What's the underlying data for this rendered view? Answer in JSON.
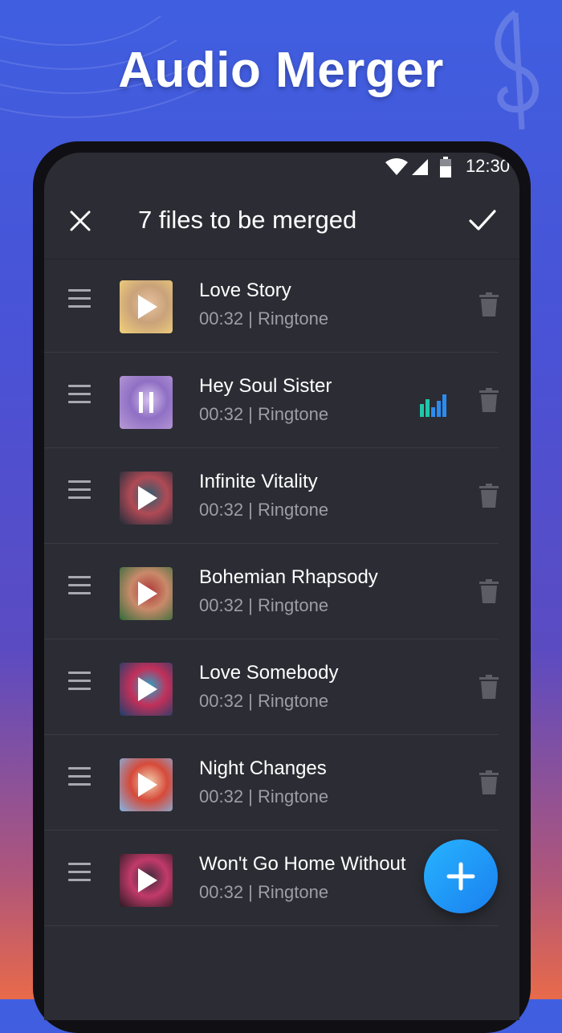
{
  "promo": {
    "title": "Audio Merger"
  },
  "status_bar": {
    "time": "12:30"
  },
  "app_bar": {
    "title": "7 files to be merged"
  },
  "tracks": [
    {
      "title": "Love Story",
      "meta": "00:32 | Ringtone",
      "state": "paused-play",
      "thumb_colors": [
        "#f2d27a",
        "#c9a27a",
        "#e7c2a0"
      ]
    },
    {
      "title": "Hey Soul Sister",
      "meta": "00:32 | Ringtone",
      "state": "playing",
      "thumb_colors": [
        "#b79ad6",
        "#8f6fc4",
        "#d6c2ee"
      ]
    },
    {
      "title": "Infinite Vitality",
      "meta": "00:32 | Ringtone",
      "state": "paused-play",
      "thumb_colors": [
        "#1d2b3a",
        "#b04a55",
        "#2c5d6e"
      ]
    },
    {
      "title": "Bohemian Rhapsody",
      "meta": "00:32 | Ringtone",
      "state": "paused-play",
      "thumb_colors": [
        "#2f6b3a",
        "#c98a6a",
        "#b03a3a"
      ]
    },
    {
      "title": "Love Somebody",
      "meta": "00:32 | Ringtone",
      "state": "paused-play",
      "thumb_colors": [
        "#1a3f6a",
        "#c2305a",
        "#2aa6c8"
      ]
    },
    {
      "title": "Night Changes",
      "meta": "00:32 | Ringtone",
      "state": "paused-play",
      "thumb_colors": [
        "#7fb6e6",
        "#d64a3a",
        "#f2d2b0"
      ]
    },
    {
      "title": "Won't Go Home Without",
      "meta": "00:32 | Ringtone",
      "state": "paused-play",
      "thumb_colors": [
        "#2a1a22",
        "#c23a6a",
        "#3a2a3a"
      ]
    }
  ],
  "colors": {
    "screen_bg": "#2c2c34",
    "fab_start": "#27b4ff",
    "fab_end": "#1a7fef",
    "equalizer": [
      "#1fc7a8",
      "#2a8cf0"
    ]
  },
  "icons": [
    "wifi-icon",
    "signal-icon",
    "battery-icon",
    "close-icon",
    "check-icon",
    "drag-handle-icon",
    "play-icon",
    "pause-icon",
    "equalizer-icon",
    "trash-icon",
    "plus-icon"
  ]
}
